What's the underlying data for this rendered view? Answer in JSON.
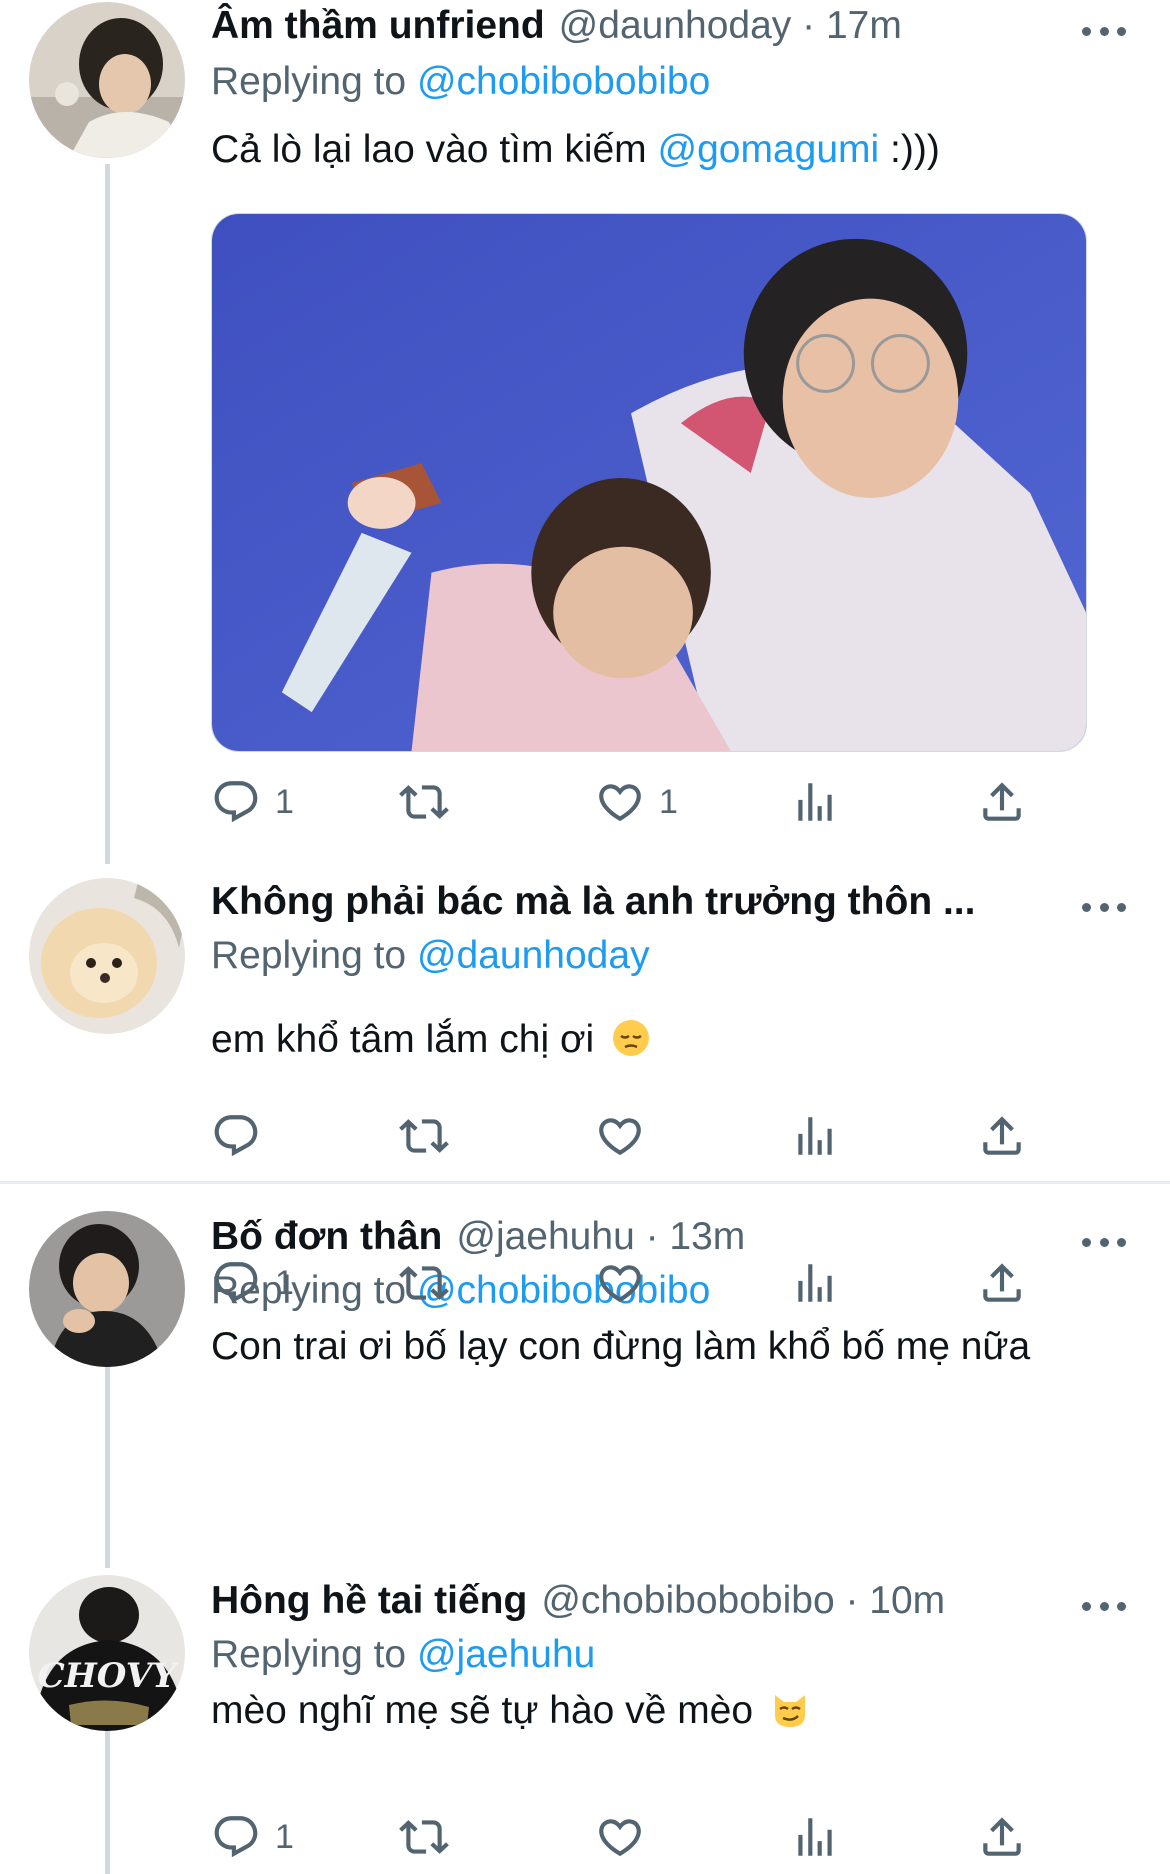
{
  "tweets": [
    {
      "name": "Âm thầm unfriend",
      "meta": "@daunhoday · 17m",
      "replying_prefix": "Replying to ",
      "replying_handle": "@chobibobobibo",
      "text_before": "Cả lò lại lao vào tìm kiếm ",
      "text_mention": "@gomagumi",
      "text_after": " :)))",
      "reply_count": "1",
      "like_count": "1",
      "has_media": true
    },
    {
      "name": "Không phải bác mà là anh trưởng thôn ...",
      "meta": "",
      "replying_prefix": "Replying to ",
      "replying_handle": "@daunhoday",
      "text": "em khổ tâm lắm chị ơi",
      "emoji": "pensive-face",
      "reply_count": "",
      "like_count": ""
    },
    {
      "name": "Bố đơn thân",
      "meta": "@jaehuhu · 13m",
      "replying_prefix": "Replying to ",
      "replying_handle": "@chobibobobibo",
      "text": "Con trai ơi bố lạy con đừng làm khổ bố mẹ nữa",
      "reply_count": "1",
      "like_count": ""
    },
    {
      "name": "Hông hề tai tiếng",
      "meta": "@chobibobobibo · 10m",
      "replying_prefix": "Replying to ",
      "replying_handle": "@jaehuhu",
      "text": "mèo nghĩ mẹ sẽ tự hào về mèo",
      "emoji": "smirking-cat-face",
      "reply_count": "1",
      "like_count": ""
    }
  ],
  "avatar_text": "CHOVY",
  "icons": {
    "reply": "reply-icon",
    "retweet": "retweet-icon",
    "like": "heart-icon",
    "views": "analytics-icon",
    "share": "share-icon",
    "more": "more-icon"
  },
  "colors": {
    "link": "#1d9bf0",
    "secondary": "#536471",
    "thread_line": "#cfd9de",
    "divider": "#e6ecf0"
  }
}
